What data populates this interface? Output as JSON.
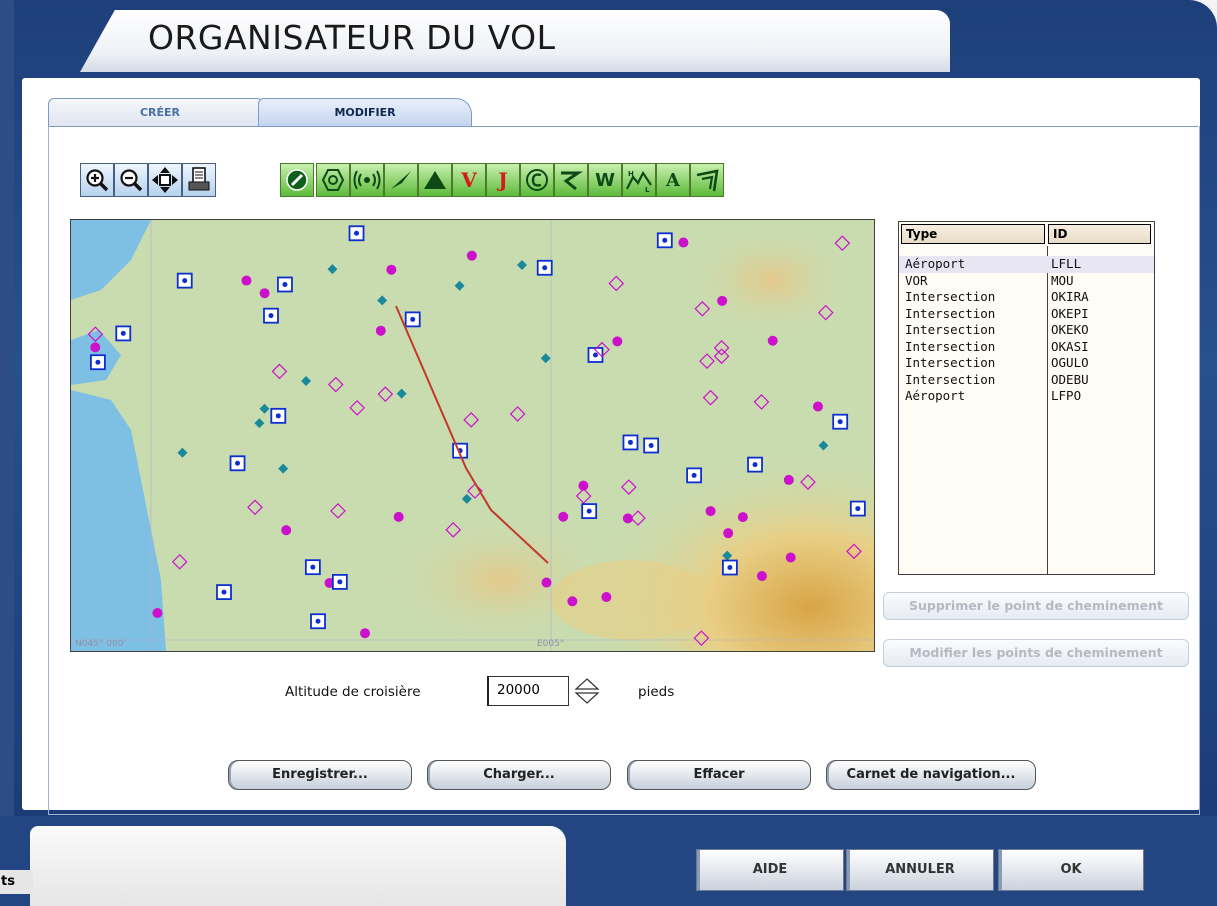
{
  "window": {
    "title": "ORGANISATEUR DU VOL"
  },
  "tabs": [
    {
      "label": "CRÉER",
      "active": false
    },
    {
      "label": "MODIFIER",
      "active": true
    }
  ],
  "toolbar": {
    "view_tools": [
      {
        "icon": "zoom-in-icon"
      },
      {
        "icon": "zoom-out-icon"
      },
      {
        "icon": "center-pan-icon"
      },
      {
        "icon": "print-icon"
      }
    ],
    "filter_tools": [
      {
        "icon": "airport-filter-icon"
      },
      {
        "icon": "vor-filter-icon"
      },
      {
        "icon": "ndb-filter-icon"
      },
      {
        "icon": "gps-path-icon"
      },
      {
        "icon": "intersection-filter-icon"
      },
      {
        "icon": "victor-airways-icon",
        "label": "V"
      },
      {
        "icon": "jet-airways-icon",
        "label": "J"
      },
      {
        "icon": "airspace-icon"
      },
      {
        "icon": "approach-icon"
      },
      {
        "icon": "waypoint-icon",
        "label": "W"
      },
      {
        "icon": "terrain-icon"
      },
      {
        "icon": "text-labels-icon",
        "label": "A"
      },
      {
        "icon": "compass-rose-icon"
      }
    ]
  },
  "map": {
    "labels": [
      "N045° 000'",
      "E005°"
    ],
    "colors": {
      "land": "#c9dcb0",
      "sea": "#7ec0e4",
      "route": "#c0392b",
      "vor": "#0d2fd0",
      "ndb": "#cc11cc",
      "intersection": "#1a8a9a"
    }
  },
  "route_table": {
    "headers": {
      "type": "Type",
      "id": "ID"
    },
    "rows": [
      {
        "type": "Aéroport",
        "id": "LFLL"
      },
      {
        "type": "VOR",
        "id": "MOU"
      },
      {
        "type": "Intersection",
        "id": "OKIRA"
      },
      {
        "type": "Intersection",
        "id": "OKEPI"
      },
      {
        "type": "Intersection",
        "id": "OKEKO"
      },
      {
        "type": "Intersection",
        "id": "OKASI"
      },
      {
        "type": "Intersection",
        "id": "OGULO"
      },
      {
        "type": "Intersection",
        "id": "ODEBU"
      },
      {
        "type": "Aéroport",
        "id": "LFPO"
      }
    ]
  },
  "side_buttons": {
    "delete_waypoint": "Supprimer le point de cheminement",
    "edit_waypoints": "Modifier les points de cheminement"
  },
  "altitude": {
    "label": "Altitude de croisière",
    "value": "20000",
    "unit": "pieds"
  },
  "actions": {
    "save": "Enregistrer...",
    "load": "Charger...",
    "clear": "Effacer",
    "navlog": "Carnet de navigation..."
  },
  "footer": {
    "help": "AIDE",
    "cancel": "ANNULER",
    "ok": "OK",
    "left_tag": "ts"
  }
}
